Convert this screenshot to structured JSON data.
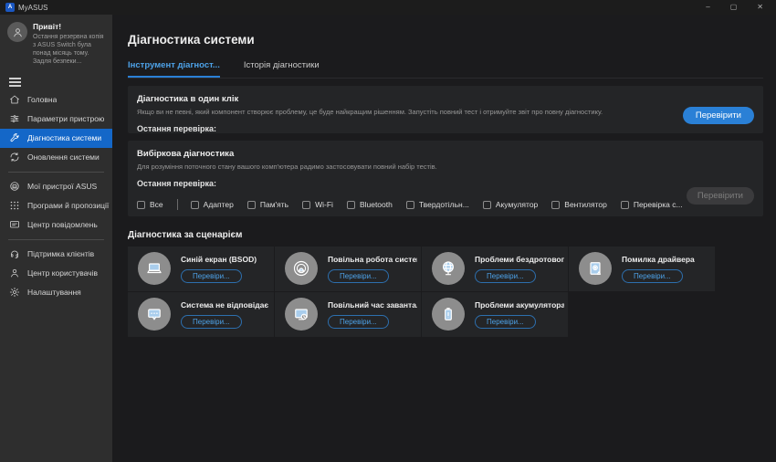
{
  "window": {
    "title": "MyASUS",
    "logo_letter": "A",
    "controls": {
      "minimize": "–",
      "maximize": "▢",
      "close": "✕"
    }
  },
  "sidebar": {
    "greeting": {
      "title": "Привіт!",
      "message": "Остання резервна копія з ASUS Switch була понад місяць тому. Задля безпеки..."
    },
    "items": [
      {
        "label": "Головна",
        "icon": "home-icon"
      },
      {
        "label": "Параметри пристрою",
        "icon": "sliders-icon"
      },
      {
        "label": "Діагностика системи",
        "icon": "wrench-icon"
      },
      {
        "label": "Оновлення системи",
        "icon": "sync-icon"
      },
      {
        "label": "Мої пристрої ASUS",
        "icon": "devices-icon"
      },
      {
        "label": "Програми й пропозиції від...",
        "icon": "apps-grid-icon"
      },
      {
        "label": "Центр повідомлень",
        "icon": "message-icon"
      },
      {
        "label": "Підтримка клієнтів",
        "icon": "headset-icon"
      },
      {
        "label": "Центр користувачів",
        "icon": "user-icon"
      },
      {
        "label": "Налаштування",
        "icon": "gear-icon"
      }
    ]
  },
  "main": {
    "page_title": "Діагностика системи",
    "tabs": [
      {
        "label": "Інструмент діагност...",
        "active": true
      },
      {
        "label": "Історія діагностики",
        "active": false
      }
    ],
    "one_click": {
      "title": "Діагностика в один клік",
      "description": "Якщо ви не певні, який компонент створює проблему, це буде найкращим рішенням. Запустіть повний тест і отримуйте звіт про повну діагностику.",
      "last_check_label": "Остання перевірка:",
      "button_label": "Перевірити"
    },
    "custom": {
      "title": "Вибіркова діагностика",
      "description": "Для розуміння поточного стану вашого комп'ютера радимо застосовувати повний набір тестів.",
      "last_check_label": "Остання перевірка:",
      "checkboxes": [
        "Все",
        "Адаптер",
        "Пам'ять",
        "Wi-Fi",
        "Bluetooth",
        "Твердотільн...",
        "Акумулятор",
        "Вентилятор",
        "Перевірка с..."
      ],
      "button_label": "Перевірити"
    },
    "scenario": {
      "title": "Діагностика за сценарієм",
      "cards": [
        {
          "title": "Синій екран (BSOD)",
          "button": "Перевіри...",
          "icon": "bsod-laptop-icon"
        },
        {
          "title": "Повільна робота системи",
          "button": "Перевіри...",
          "icon": "slow-system-gauge-icon"
        },
        {
          "title": "Проблеми бездротовог...",
          "button": "Перевіри...",
          "icon": "wireless-globe-icon"
        },
        {
          "title": "Помилка драйвера",
          "button": "Перевіри...",
          "icon": "driver-error-icon"
        },
        {
          "title": "Система не відповідає",
          "button": "Перевіри...",
          "icon": "system-not-responding-icon"
        },
        {
          "title": "Повільний час заванта...",
          "button": "Перевіри...",
          "icon": "slow-boot-icon"
        },
        {
          "title": "Проблеми акумулятора",
          "button": "Перевіри...",
          "icon": "battery-icon"
        }
      ]
    }
  },
  "colors": {
    "accent_blue": "#2a80d6",
    "tab_active_blue": "#4da2e8",
    "sidebar_selected_blue": "#1467c8",
    "card_background": "#242527",
    "page_background": "#1b1b1d"
  }
}
